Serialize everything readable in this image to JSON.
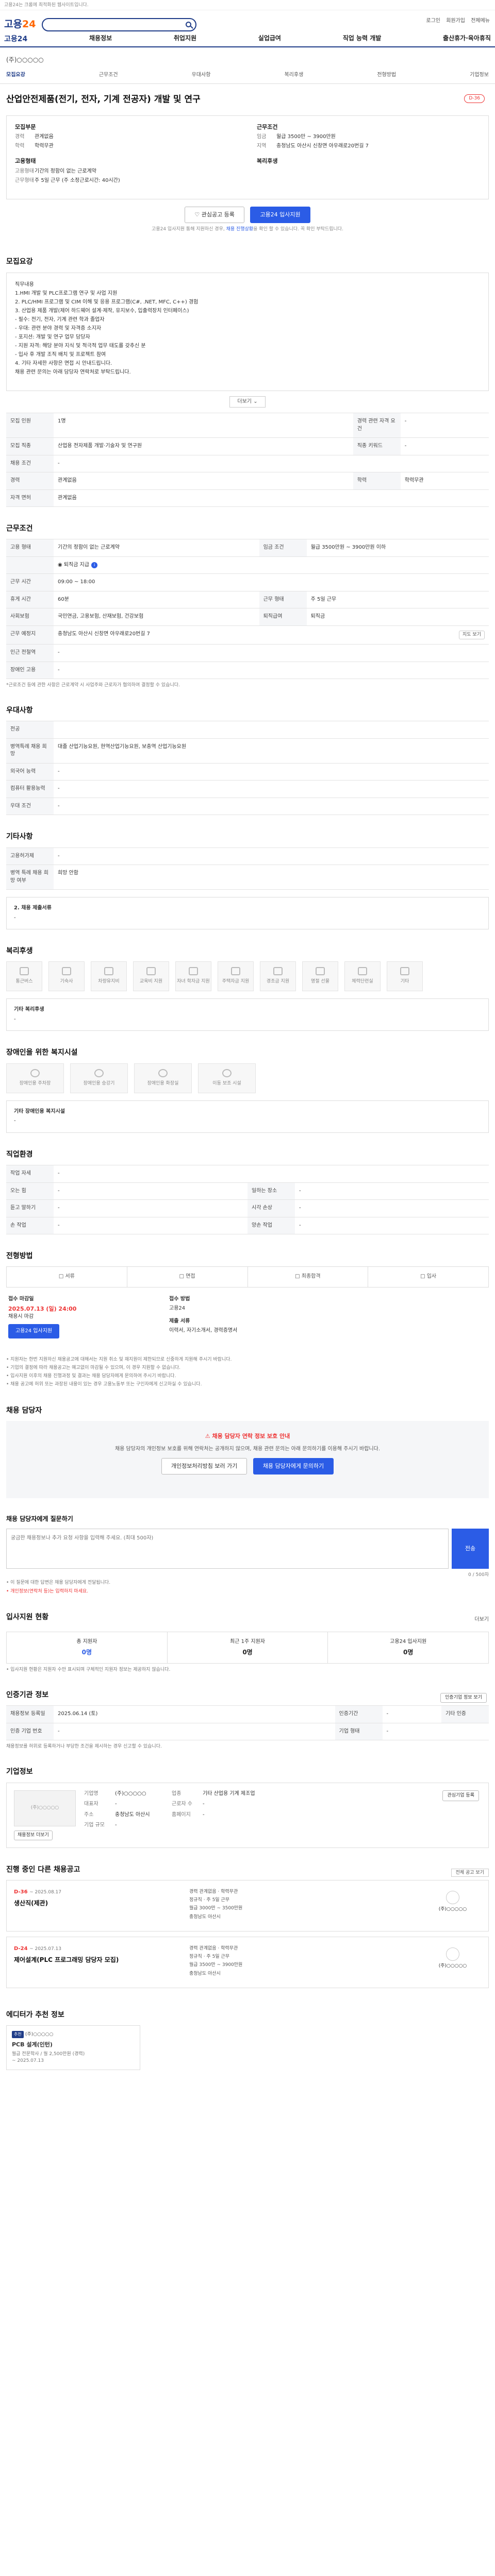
{
  "topnotice": "고용24는 크롬에 최적화된 웹사이트입니다.",
  "header": {
    "logo_main": "고용",
    "logo_num": "24",
    "search_placeholder": "",
    "links": [
      "로그인",
      "회원가입",
      "전체메뉴"
    ],
    "gnb": [
      "고용24",
      "채용정보",
      "취업지원",
      "실업급여",
      "직업 능력 개발",
      "출산휴가·육아휴직"
    ]
  },
  "job": {
    "company": "(주)○○○○○",
    "tabs": [
      "모집요강",
      "근무조건",
      "우대사항",
      "복리후생",
      "전형방법",
      "기업정보"
    ],
    "title": "산업안전제품(전기, 전자, 기계 전공자) 개발 및 연구",
    "dday": "D-36",
    "summary": {
      "left_groups": [
        {
          "head": "모집부문",
          "rows": [
            {
              "k": "경력",
              "v": "관계없음"
            },
            {
              "k": "학력",
              "v": "학력무관"
            }
          ]
        },
        {
          "head": "고용형태",
          "rows": [
            {
              "k": "고용형태",
              "v": "기간의 정함이 없는 근로계약"
            },
            {
              "k": "근무형태",
              "v": "주 5일 근무 (주 소정근로시간: 40시간)"
            }
          ]
        }
      ],
      "right_groups": [
        {
          "head": "근무조건",
          "rows": [
            {
              "k": "임금",
              "v": "월급 3500만 ~ 3900만원"
            },
            {
              "k": "지역",
              "v": "충청남도 아산시 신창면 아우래로20번길 7"
            }
          ]
        },
        {
          "head": "복리후생",
          "rows": []
        }
      ]
    },
    "btn_scrap": "관심공고 등록",
    "btn_apply": "고용24 입사지원",
    "note_prefix": "고용24 입사지원 통해 지원하신 경우,",
    "note_link": "채용 진행상황",
    "note_suffix": "을 확인 할 수 있습니다. 꼭 확인 부탁드립니다."
  },
  "sections": {
    "recruit": {
      "title": "모집요강",
      "body": "직무내용\n1.HMI 개발 및 PLC프로그램 연구 및 사업 지원\n2. PLC/HMI 프로그램 및 CIM 이해 및 응용 프로그램(C#, .NET, MFC, C++) 경험\n3. 산업용 제품 개발(제어 하드웨어 설계·제작, 유지보수, 입출력장치 인터페이스)\n - 필수: 전기, 전자, 기계 관련 학과 졸업자\n - 우대: 관련 분야 경력 및 자격증 소지자\n - 포지션: 개발 및 연구 업무 담당자\n - 지원 자격: 해당 분야 지식 및 적극적 업무 태도를 갖추신 분\n - 입사 후 개발 조직 배치 및 프로젝트 참여\n4. 기타 자세한 사항은 면접 시 안내드립니다.\n채용 관련 문의는 아래 담당자 연락처로 부탁드립니다.",
      "more": "더보기",
      "rows": [
        [
          {
            "k": "모집 인원",
            "v": "1명"
          },
          {
            "k": "경력 관련 자격 요건",
            "v": "-"
          }
        ],
        [
          {
            "k": "모집 직종",
            "v": "산업용 전자제품 개발·기술자 및 연구원"
          },
          {
            "k": "직종 키워드",
            "v": "-"
          }
        ],
        [
          {
            "k": "채용 조건",
            "v": "-"
          },
          {
            "k": "",
            "v": ""
          }
        ],
        [
          {
            "k": "경력",
            "v": "관계없음"
          },
          {
            "k": "학력",
            "v": "학력무관"
          }
        ],
        [
          {
            "k": "자격 면허",
            "v": "관계없음"
          },
          {
            "k": "",
            "v": ""
          }
        ]
      ]
    },
    "conditions": {
      "title": "근무조건",
      "rows": [
        {
          "k": "고용 형태",
          "v": "기간의 정함이 없는 근로계약",
          "k2": "임금 조건",
          "v2": "월급 3500만원 ~ 3900만원 이하"
        },
        {
          "k": "",
          "v": "퇴직금 지급",
          "k2": "",
          "v2": ""
        },
        {
          "k": "근무 시간",
          "v": "09:00 ~ 18:00",
          "k2": "",
          "v2": ""
        },
        {
          "k": "휴게 시간",
          "v": "60분",
          "k2": "근무 형태",
          "v2": "주 5일 근무"
        },
        {
          "k": "사회보험",
          "v": "국민연금, 고용보험, 산재보험, 건강보험",
          "k2": "퇴직급여",
          "v2": "퇴직금"
        },
        {
          "k": "근무 예정지",
          "v": "충청남도 아산시 신창면 아우래로20번길 7",
          "k2": "",
          "v2": ""
        },
        {
          "k": "인근 전철역",
          "v": "-",
          "k2": "",
          "v2": ""
        },
        {
          "k": "장애인 고용",
          "v": "-",
          "k2": "",
          "v2": ""
        }
      ],
      "btn_map": "지도 보기",
      "note": "*근로조건 등에 관한 사항은 근로계약 시 사업주와 근로자가 협의하여 결정할 수 있습니다."
    },
    "preference": {
      "title": "우대사항",
      "rows": [
        {
          "k": "전공",
          "v": ""
        },
        {
          "k": "병역특례 채용 희망",
          "v": "대졸 산업기능요원, 현역산업기능요원, 보충역 산업기능요원"
        },
        {
          "k": "외국어 능력",
          "v": "-"
        },
        {
          "k": "컴퓨터 활용능력",
          "v": "-"
        },
        {
          "k": "우대 조건",
          "v": "-"
        }
      ]
    },
    "etc": {
      "title": "기타사항",
      "rows": [
        {
          "k": "고용허가제",
          "v": "-"
        },
        {
          "k": "병역 특례 채용 희망 여부",
          "v": "희망 안함"
        }
      ],
      "subtitle": "2. 채용 제출서류",
      "subvalue": "-"
    },
    "welfare": {
      "title": "복리후생",
      "icons_row1": [
        "통근버스",
        "기숙사",
        "차량유지비",
        "교육비 지원",
        "자녀 학자금 지원"
      ],
      "icons_row2": [
        "주택자금 지원",
        "경조금 지원",
        "명절 선물",
        "체력단련실",
        "기타"
      ],
      "box_title": "기타 복리후생",
      "box_value": "-"
    },
    "disability": {
      "title": "장애인을 위한 복지시설",
      "icons": [
        "장애인용 주차장",
        "장애인용 승강기",
        "장애인용 화장실",
        "이동 보조 시설"
      ],
      "box_title": "기타 장애인용 복지시설",
      "box_value": "-"
    },
    "work": {
      "title": "직업환경",
      "rows": [
        {
          "k": "작업 자세",
          "v": "-",
          "k2": "",
          "v2": ""
        },
        {
          "k": "오는 힘",
          "v": "-",
          "k2": "일하는 장소",
          "v2": "-"
        },
        {
          "k": "듣고 말하기",
          "v": "-",
          "k2": "시각 손상",
          "v2": "-"
        },
        {
          "k": "손 작업",
          "v": "-",
          "k2": "양손 작업",
          "v2": "-"
        }
      ]
    },
    "apply": {
      "title": "전형방법",
      "flow": [
        "서류",
        "면접",
        "최종합격",
        "입사"
      ],
      "h_deadline": "접수 마감일",
      "deadline": "2025.07.13 (일) 24:00",
      "deadline_sub": "채용시 마감",
      "apply_btn": "고용24 입사지원",
      "h_method": "접수 방법",
      "method": "고용24",
      "h_docs": "제출 서류",
      "docs": "이력서, 자기소개서, 경력증명서",
      "notices": [
        "• 지원자는 한번 지원하신 채용공고에 대해서는 지원 취소 및 재지원이 제한되므로 신중하게 지원해 주시기 바랍니다.",
        "• 기업의 결정에 따라 채용공고는 예고없이 마감될 수 있으며, 이 경우 지원할 수 없습니다.",
        "• 입사지원 이후의 채용 진행과정 및 결과는 채용 담당자에게 문의하여 주시기 바랍니다.",
        "• 채용 공고에 허위 또는 과장된 내용이 있는 경우 고용노동부 또는 구인자에게 신고하실 수 있습니다."
      ]
    },
    "contact": {
      "title": "채용 담당자",
      "alert": "채용 담당자 연락 정보 보호 안내",
      "desc": "채용 담당자의 개인정보 보호를 위해 연락처는 공개하지 않으며, 채용 관련 문의는 아래 문의하기를 이용해 주시기 바랍니다.",
      "btn_left": "개인정보처리방침 보러 가기",
      "btn_right": "채용 담당자에게 문의하기"
    },
    "qa": {
      "title": "채용 담당자에게 질문하기",
      "placeholder": "궁금한 채용정보나 추가 요청 사항을 입력해 주세요. (최대 500자)",
      "send": "전송",
      "counter": "0 / 500자",
      "notes": [
        "• 이 질문에 대한 답변은 채용 담당자에게 전달됩니다.",
        "• 개인정보(연락처 등)는 입력하지 마세요."
      ]
    },
    "stats": {
      "title": "입사지원 현황",
      "more": "더보기",
      "items": [
        {
          "label": "총 지원자",
          "n": "0명"
        },
        {
          "label": "최근 1주 지원자",
          "n": "0명"
        },
        {
          "label": "고용24 입사지원",
          "n": "0명"
        }
      ],
      "note": "• 입사지원 현황은 지원자 수만 표시되며 구체적인 지원자 정보는 제공하지 않습니다."
    },
    "manage": {
      "title": "인증기관 정보",
      "btn": "인증기업 정보 보기",
      "rows": [
        {
          "k": "채용정보 등록일",
          "v": "2025.06.14 (토)",
          "k2": "인증기간",
          "v2": "-",
          "k3": "기타 인증"
        },
        {
          "k": "인증 기업 번호",
          "v": "-",
          "k2": "기업 형태",
          "v2": "-",
          "k3": ""
        }
      ],
      "note": "채용정보를 허위로 등록하거나 부당한 조건을 제시하는 경우 신고할 수 있습니다."
    },
    "company": {
      "title": "기업정보",
      "logo_text": "(주)○○○○○",
      "btn_more": "채용정보 더보기",
      "btn_follow": "관심기업 등록",
      "rows": [
        {
          "k": "기업명",
          "v": "(주)○○○○○",
          "k2": "업종",
          "v2": "기타 산업용 기계 제조업"
        },
        {
          "k": "대표자",
          "v": "-",
          "k2": "근로자 수",
          "v2": "-"
        },
        {
          "k": "주소",
          "v": "충청남도 아산시",
          "k2": "홈페이지",
          "v2": "-"
        },
        {
          "k": "기업 규모",
          "v": "-",
          "k2": "",
          "v2": ""
        }
      ]
    },
    "others": {
      "title": "진행 중인 다른 채용공고",
      "buttons": [
        "전체 공고 보기"
      ],
      "cards": [
        {
          "dd": "D-36",
          "period": "~ 2025.08.17",
          "title": "생산직(제관)",
          "lines": [
            "경력 관계없음 · 학력무관",
            "정규직 · 주 5일 근무",
            "월급 3000만 ~ 3500만원",
            "충청남도 아산시"
          ],
          "company": "(주)○○○○○"
        },
        {
          "dd": "D-24",
          "period": "~ 2025.07.13",
          "title": "제어설계(PLC 프로그래밍 담당자 모집)",
          "lines": [
            "경력 관계없음 · 학력무관",
            "정규직 · 주 5일 근무",
            "월급 3500만 ~ 3900만원",
            "충청남도 아산시"
          ],
          "company": "(주)○○○○○"
        }
      ]
    },
    "recommend": {
      "title": "에디터가 추천 정보",
      "item": {
        "badge": "추천",
        "company": "(주)○○○○○",
        "title": "PCB 설계(인턴)",
        "lines": [
          "월급 전문학사 / 월 2,500만원 (경력)",
          "~ 2025.07.13"
        ]
      }
    }
  }
}
